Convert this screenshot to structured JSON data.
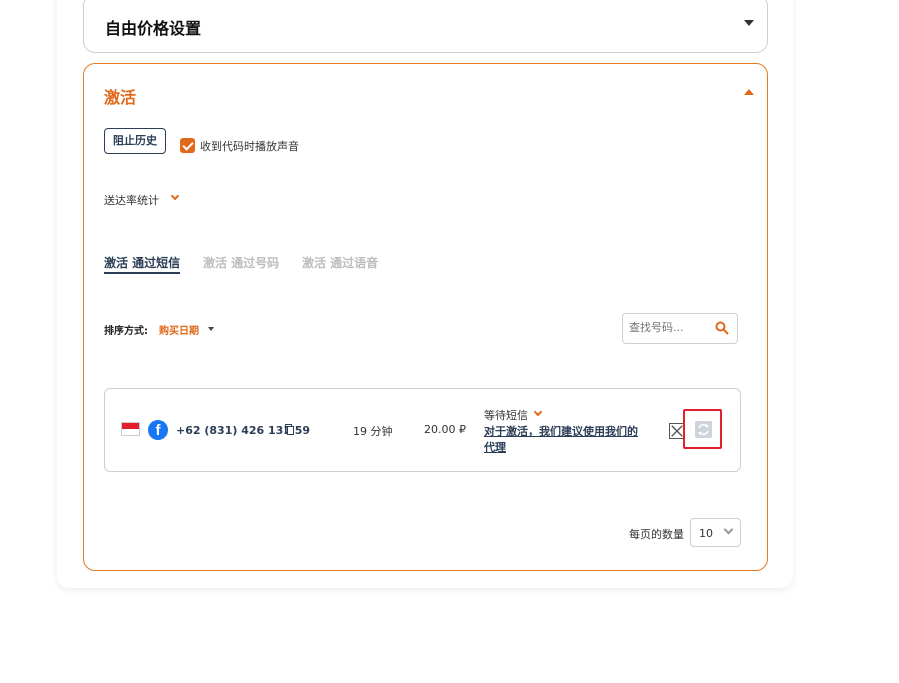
{
  "sections": {
    "price_settings": {
      "title": "自由价格设置"
    },
    "activation": {
      "title": "激活",
      "block_history_label": "阻止历史",
      "sound_checkbox_label": "收到代码时播放声音",
      "sound_checked": true,
      "delivery_stats_label": "送达率统计",
      "tabs": [
        {
          "label": "激活 通过短信",
          "active": true
        },
        {
          "label": "激活 通过号码",
          "active": false
        },
        {
          "label": "激活 通过语音",
          "active": false
        }
      ],
      "sort": {
        "label": "排序方式:",
        "value": "购买日期"
      },
      "search": {
        "placeholder": "查找号码..."
      },
      "rows": [
        {
          "country_flag": "indonesia-flag",
          "service_icon": "facebook-icon",
          "phone": "+62 (831) 426 131 59",
          "duration": "19 分钟",
          "price": "20.00 ₽",
          "status": "等待短信",
          "proxy_link": "对于激活，我们建议使用我们的代理"
        }
      ],
      "pagination": {
        "per_page_label": "每页的数量",
        "per_page_value": "10"
      }
    }
  },
  "colors": {
    "accent": "#e0691a",
    "navy": "#2c3e57",
    "highlight": "#e5202e"
  }
}
